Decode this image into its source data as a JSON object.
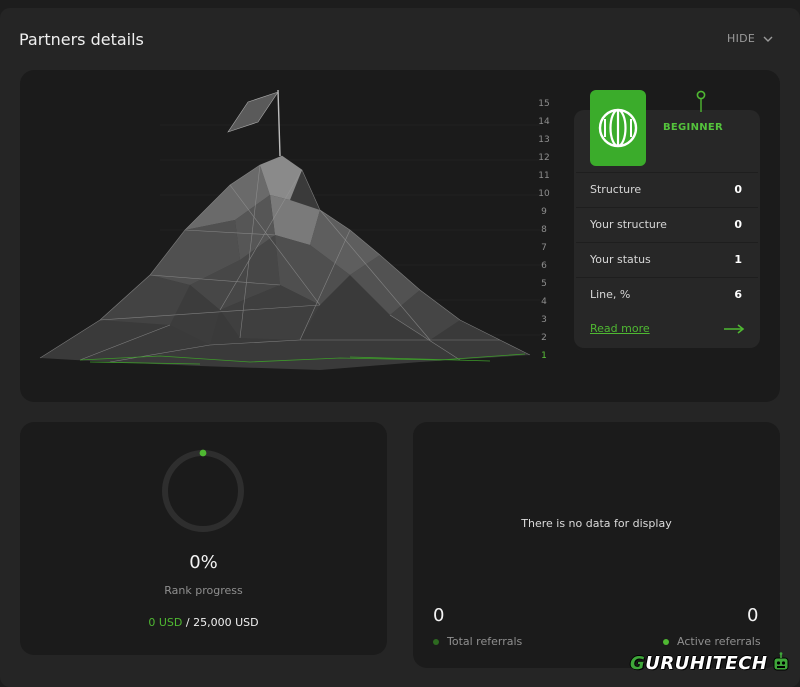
{
  "header": {
    "title": "Partners details",
    "hide_label": "HIDE"
  },
  "scale": {
    "levels": [
      "15",
      "14",
      "13",
      "12",
      "11",
      "10",
      "9",
      "8",
      "7",
      "6",
      "5",
      "4",
      "3",
      "2",
      "1"
    ],
    "current_level": "1"
  },
  "rank": {
    "name": "BEGINNER",
    "rows": [
      {
        "label": "Structure",
        "value": "0"
      },
      {
        "label": "Your structure",
        "value": "0"
      },
      {
        "label": "Your status",
        "value": "1"
      },
      {
        "label": "Line, %",
        "value": "6"
      }
    ],
    "read_more": "Read more"
  },
  "progress": {
    "percent_text": "0%",
    "percent_value": 0,
    "label": "Rank progress",
    "current": "0 USD",
    "separator": "/",
    "target": "25,000 USD"
  },
  "referrals": {
    "empty_message": "There is no data for display",
    "total_value": "0",
    "total_label": "Total referrals",
    "active_value": "0",
    "active_label": "Active referrals"
  },
  "watermark": {
    "text_main": "URUHITECH",
    "text_first": "G"
  },
  "colors": {
    "accent": "#4fb832",
    "badge": "#3bac2b",
    "panel": "#1b1b1b",
    "card": "#272727"
  },
  "icons": {
    "chevron": "chevron-down-icon",
    "globe": "globe-icon",
    "pin": "pin-icon",
    "arrow": "arrow-right-icon",
    "flag": "flag-icon"
  }
}
